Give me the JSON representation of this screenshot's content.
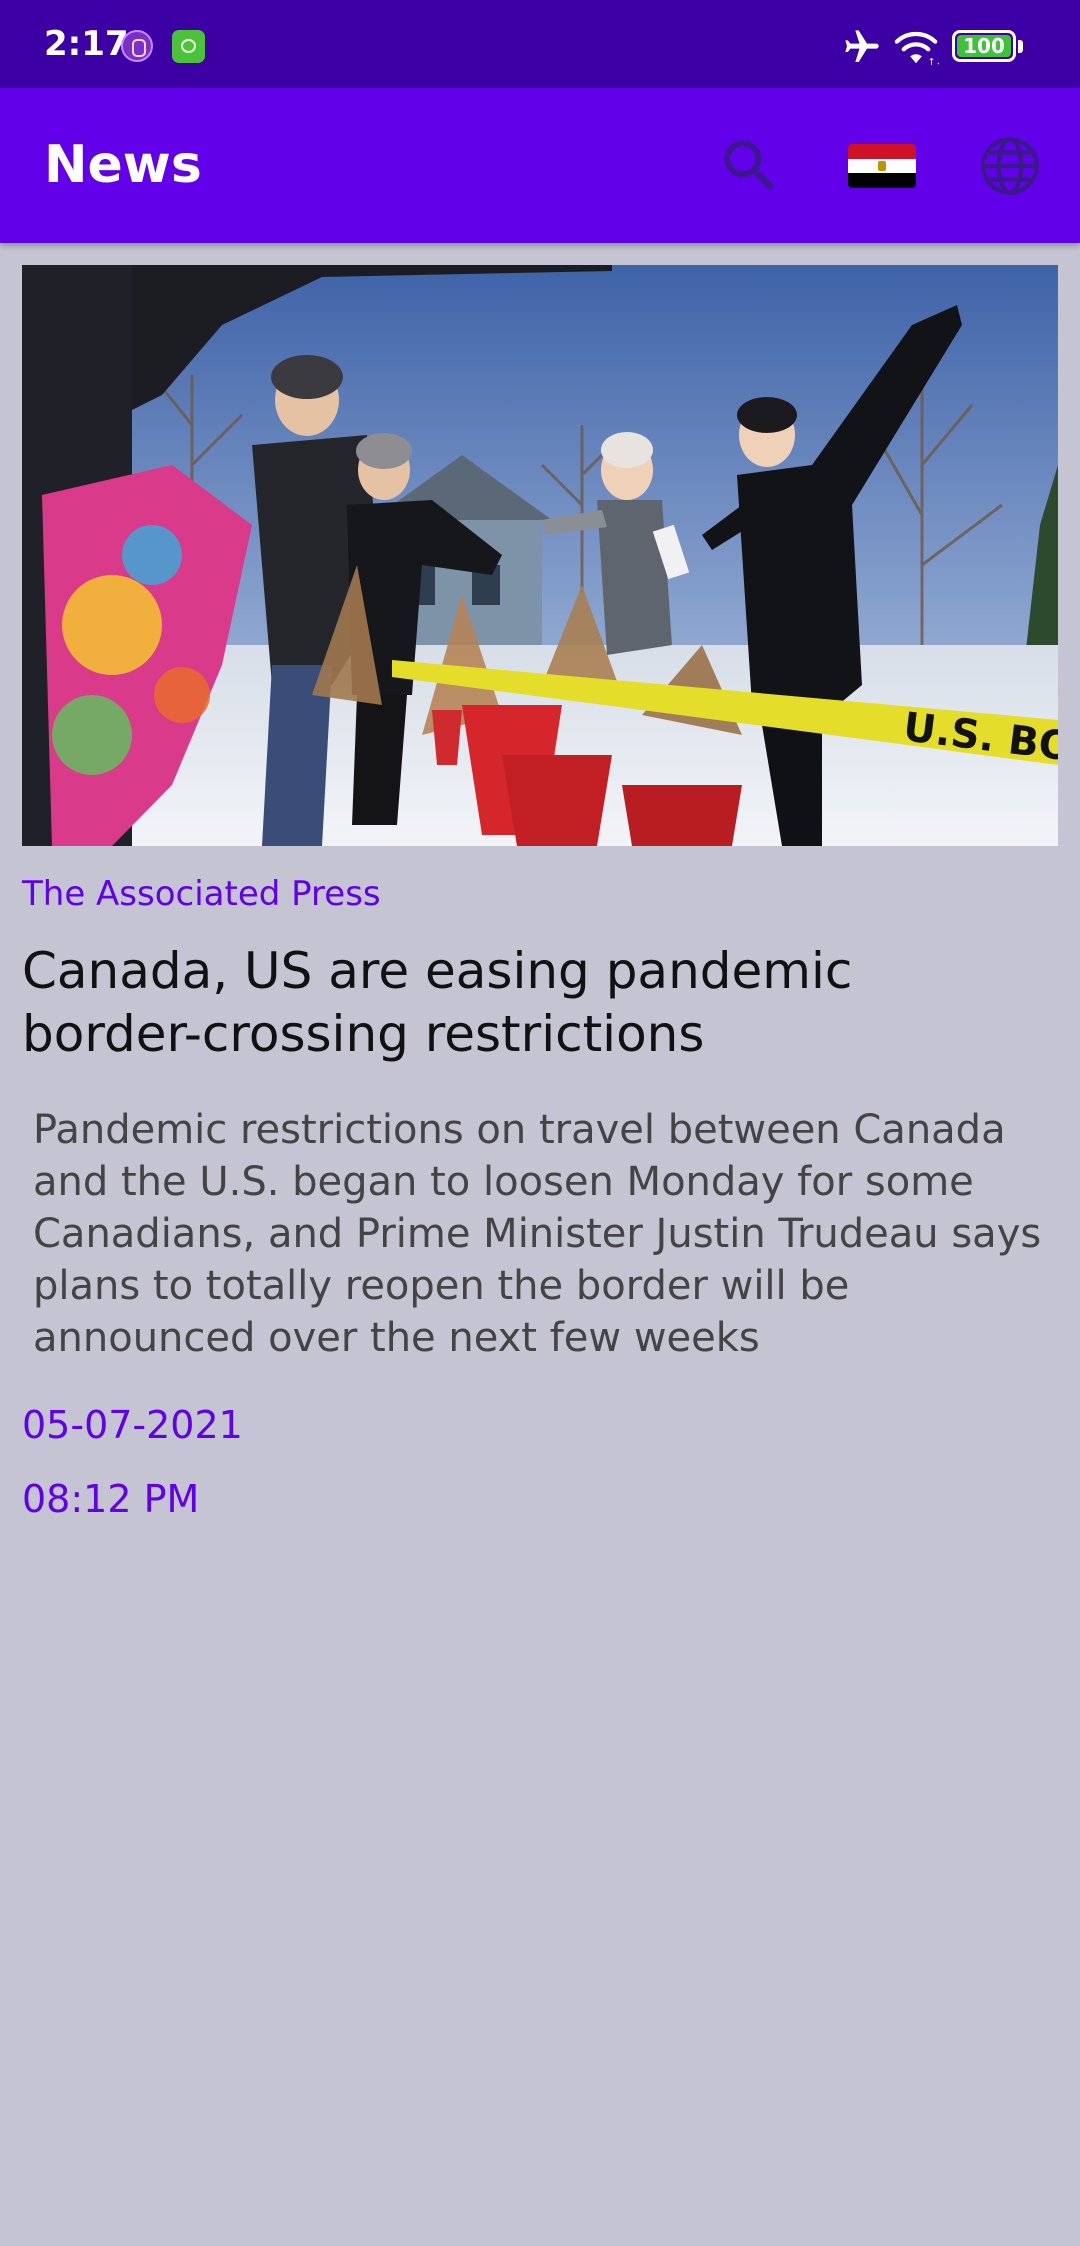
{
  "status_bar": {
    "time": "2:17",
    "battery_level": "100",
    "icons": [
      "notification-icon",
      "cat-icon",
      "airplane-icon",
      "wifi-icon",
      "battery-icon"
    ]
  },
  "app_bar": {
    "title": "News",
    "actions": [
      "search-icon",
      "egypt-flag-icon",
      "globe-icon"
    ]
  },
  "article": {
    "source": "The Associated Press",
    "title": "Canada, US are easing pandemic border-crossing restrictions",
    "description": "Pandemic restrictions on travel between Canada and the U.S. began to loosen Monday for some Canadians, and Prime Minister Justin Trudeau says plans to totally reopen the border will be announced over the next few weeks",
    "date": "05-07-2021",
    "time": "08:12 PM",
    "image_tape_text": "U.S. BORDER"
  },
  "colors": {
    "status_bar": "#3d00a4",
    "app_bar": "#6200ea",
    "background": "#c4c4d2",
    "accent_text": "#6200ea"
  }
}
